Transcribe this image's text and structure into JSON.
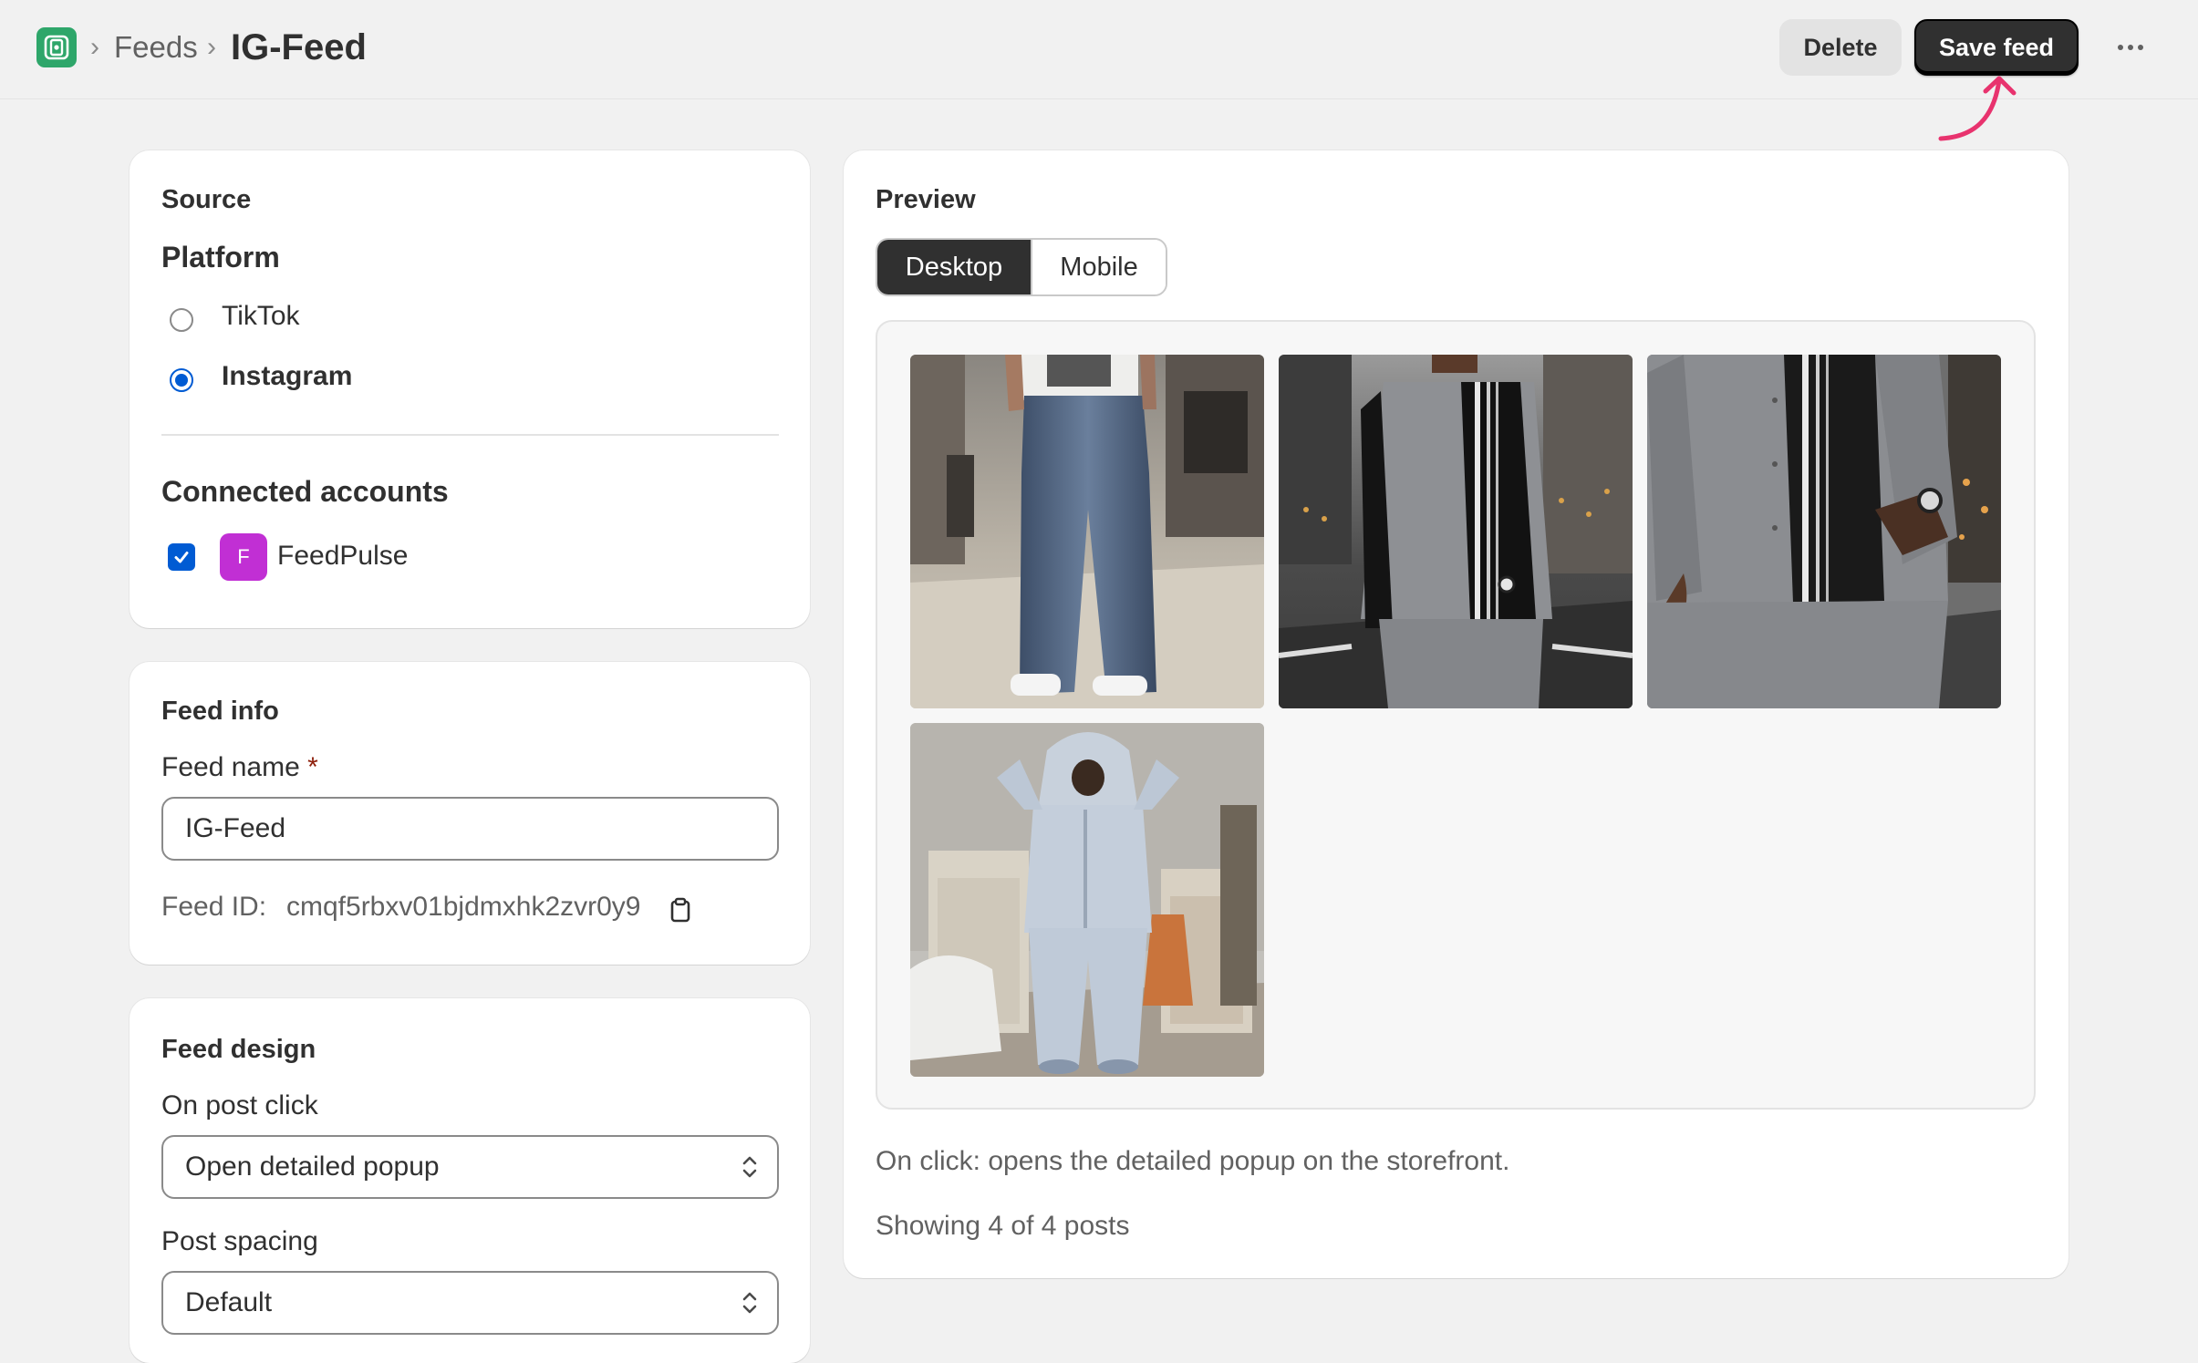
{
  "header": {
    "breadcrumb_parent": "Feeds",
    "title": "IG-Feed",
    "delete_label": "Delete",
    "save_label": "Save feed",
    "more_icon": "ellipsis-horizontal-icon",
    "app_icon": "app-logo-icon"
  },
  "source": {
    "title": "Source",
    "platform_heading": "Platform",
    "platforms": [
      {
        "label": "TikTok",
        "selected": false
      },
      {
        "label": "Instagram",
        "selected": true
      }
    ],
    "connected_heading": "Connected accounts",
    "accounts": [
      {
        "initial": "F",
        "name": "FeedPulse",
        "checked": true
      }
    ]
  },
  "feed_info": {
    "title": "Feed info",
    "name_label": "Feed name",
    "required_mark": "*",
    "name_value": "IG-Feed",
    "id_label": "Feed ID:",
    "id_value": "cmqf5rbxv01bjdmxhk2zvr0y9"
  },
  "feed_design": {
    "title": "Feed design",
    "on_click_label": "On post click",
    "on_click_value": "Open detailed popup",
    "spacing_label": "Post spacing",
    "spacing_value": "Default"
  },
  "preview": {
    "title": "Preview",
    "tabs": [
      {
        "label": "Desktop",
        "active": true
      },
      {
        "label": "Mobile",
        "active": false
      }
    ],
    "posts": [
      {
        "name": "post-baggy-jeans"
      },
      {
        "name": "post-grey-striped-shirt"
      },
      {
        "name": "post-grey-shirt-closeup"
      },
      {
        "name": "post-grey-tracksuit"
      }
    ],
    "click_note": "On click: opens the detailed popup on the storefront.",
    "count_text": "Showing 4 of 4 posts"
  },
  "colors": {
    "primary_button": "#303030",
    "radio_accent": "#005bd3",
    "avatar": "#c12fd4",
    "annotation_arrow": "#e8336e",
    "app_icon": "#2ea66a"
  }
}
